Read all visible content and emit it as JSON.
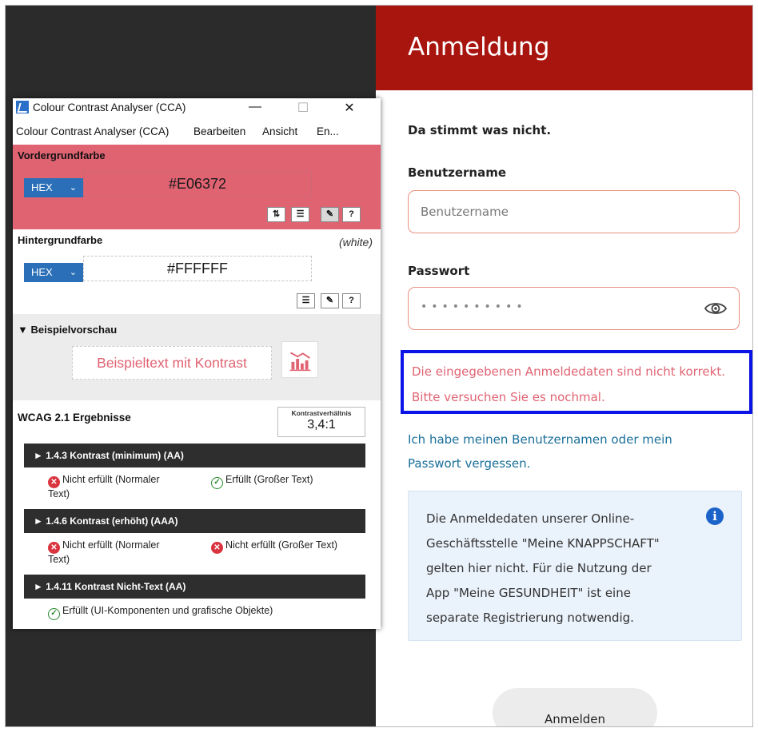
{
  "login": {
    "title": "Anmeldung",
    "error_heading": "Da stimmt was nicht.",
    "username_label": "Benutzername",
    "username_placeholder": "Benutzername",
    "password_label": "Passwort",
    "password_value": "••••••••••",
    "error_message_line1": "Die eingegebenen Anmeldedaten sind nicht korrekt.",
    "error_message_line2": "Bitte versuchen Sie es nochmal.",
    "forgot_line1": "Ich habe meinen Benutzernamen oder mein",
    "forgot_line2": "Passwort vergessen.",
    "info_lines": [
      "Die Anmeldedaten unserer Online-",
      "Geschäftsstelle \"Meine KNAPPSCHAFT\"",
      "gelten hier nicht. Für die Nutzung der",
      "App \"Meine GESUNDHEIT\" ist eine",
      "separate Registrierung notwendig."
    ],
    "submit_label": "Anmelden",
    "colors": {
      "header": "#a8140e",
      "error_text": "#e06372",
      "link": "#1a6f9a",
      "highlight_border": "#0a14e6"
    }
  },
  "cca": {
    "window_title": "Colour Contrast Analyser (CCA)",
    "window_buttons": {
      "minimize": "—",
      "maximize": "☐",
      "close": "✕"
    },
    "menu": [
      "Colour Contrast Analyser (CCA)",
      "Bearbeiten",
      "Ansicht",
      "En..."
    ],
    "foreground": {
      "label": "Vordergrundfarbe",
      "format": "HEX",
      "value": "#E06372"
    },
    "background": {
      "label": "Hintergrundfarbe",
      "note": "(white)",
      "format": "HEX",
      "value": "#FFFFFF"
    },
    "preview": {
      "label": "▼ Beispielvorschau",
      "text": "Beispieltext mit Kontrast"
    },
    "results": {
      "title": "WCAG 2.1 Ergebnisse",
      "ratio_label": "Kontrastverhältnis",
      "ratio_value": "3,4:1",
      "criteria": [
        {
          "title": "► 1.4.3 Kontrast (minimum) (AA)",
          "results": [
            {
              "status": "fail",
              "text_line1": "Nicht erfüllt (Normaler",
              "text_line2": "Text)"
            },
            {
              "status": "pass",
              "text_line1": "Erfüllt (Großer Text)"
            }
          ]
        },
        {
          "title": "► 1.4.6 Kontrast (erhöht) (AAA)",
          "results": [
            {
              "status": "fail",
              "text_line1": "Nicht erfüllt (Normaler",
              "text_line2": "Text)"
            },
            {
              "status": "fail",
              "text_line1": "Nicht erfüllt (Großer Text)"
            }
          ]
        },
        {
          "title": "► 1.4.11 Kontrast Nicht-Text (AA)",
          "results": [
            {
              "status": "pass",
              "text_line1": "Erfüllt (UI-Komponenten und grafische Objekte)"
            }
          ]
        }
      ]
    },
    "colors": {
      "foreground": "#e06372",
      "select": "#2a6fb8",
      "criteria_bar": "#2e2e2e"
    }
  }
}
